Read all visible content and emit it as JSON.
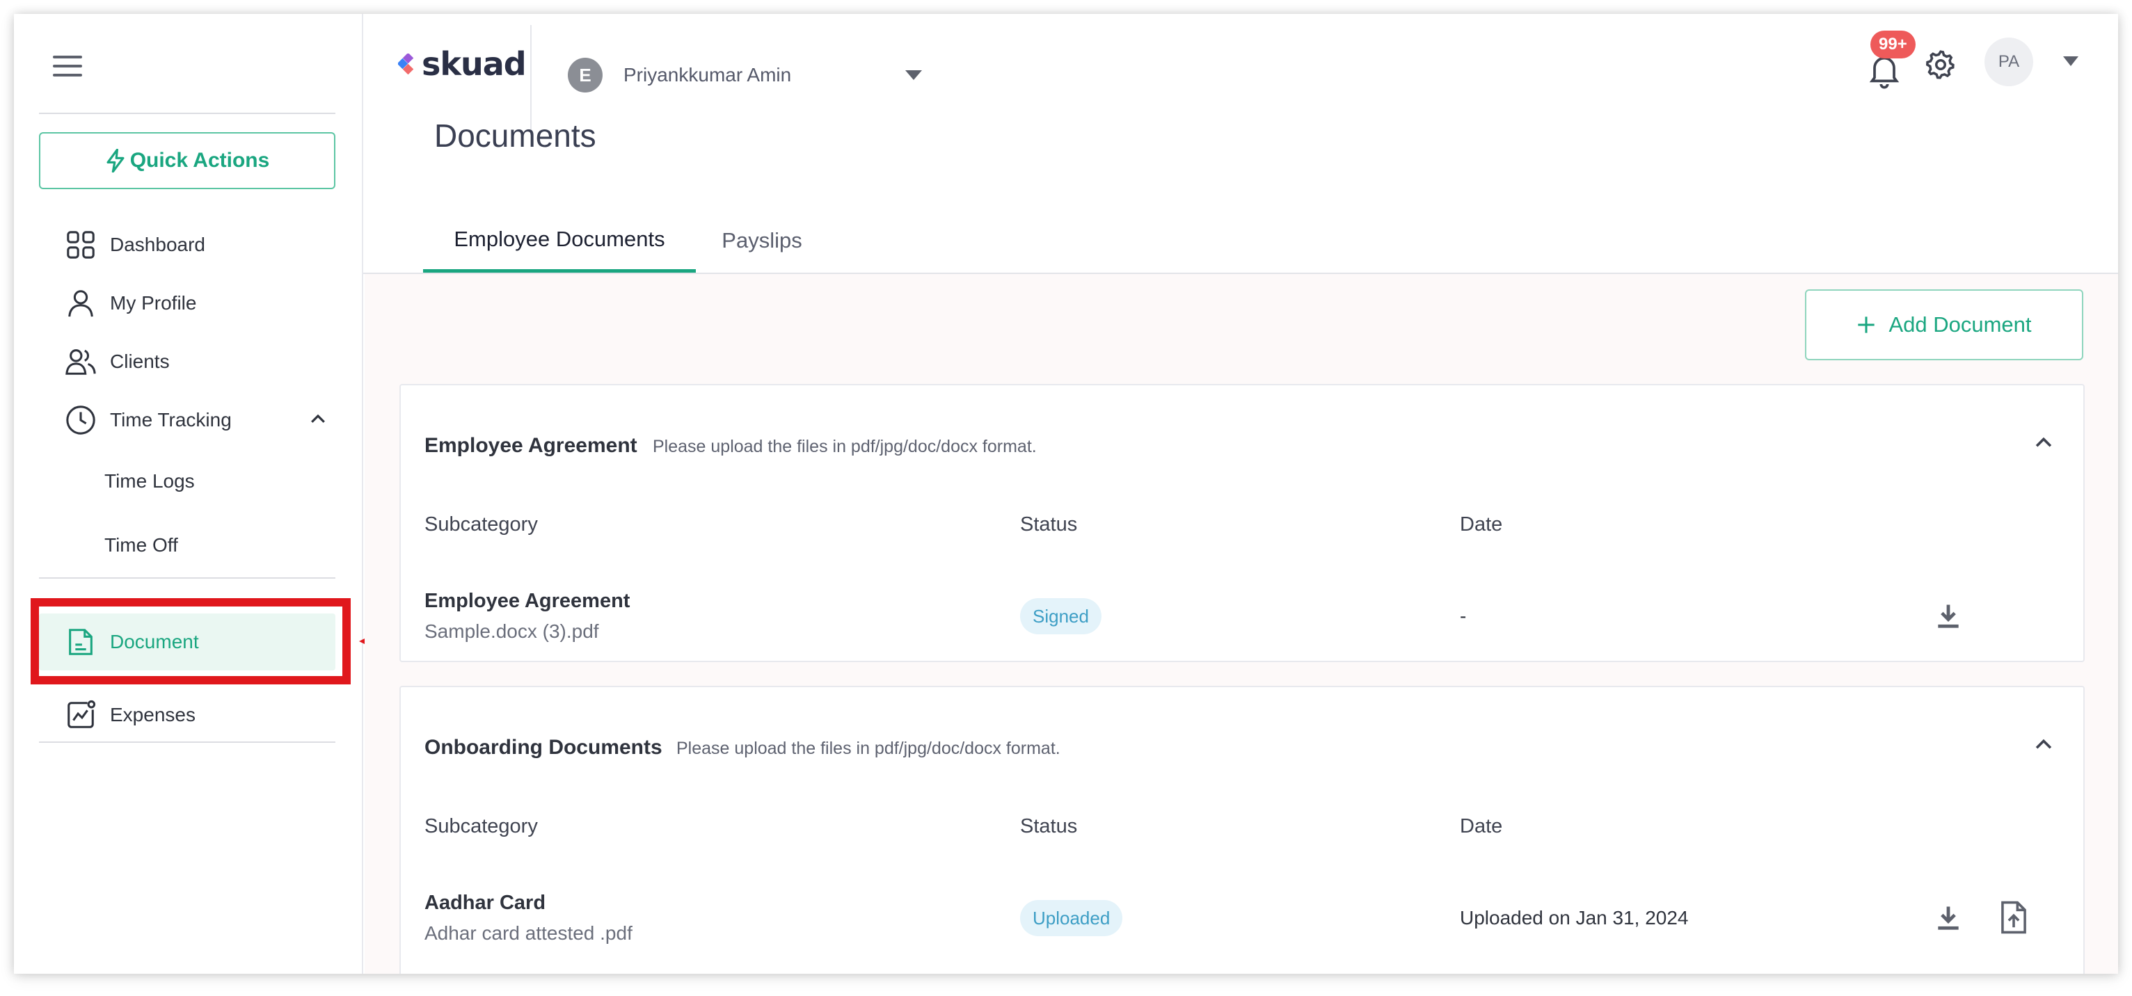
{
  "sidebar": {
    "quick_actions_label": "Quick Actions",
    "items": [
      {
        "label": "Dashboard",
        "icon": "dashboard-grid-icon"
      },
      {
        "label": "My Profile",
        "icon": "user-icon"
      },
      {
        "label": "Clients",
        "icon": "clients-icon"
      },
      {
        "label": "Time Tracking",
        "icon": "clock-icon",
        "expanded": true
      },
      {
        "label": "Time Logs"
      },
      {
        "label": "Time Off"
      },
      {
        "label": "Document",
        "icon": "document-icon",
        "active": true
      },
      {
        "label": "Expenses",
        "icon": "expenses-chart-icon"
      }
    ]
  },
  "header": {
    "logo_text": "skuad",
    "client": {
      "initial": "E",
      "name": "Priyankkumar Amin"
    },
    "notifications_badge": "99+",
    "user_initials": "PA"
  },
  "page": {
    "title": "Documents",
    "tabs": [
      {
        "label": "Employee Documents",
        "active": true
      },
      {
        "label": "Payslips",
        "active": false
      }
    ],
    "add_document_label": "Add Document"
  },
  "sections": [
    {
      "title": "Employee Agreement",
      "hint": "Please upload the files in pdf/jpg/doc/docx format.",
      "columns": [
        "Subcategory",
        "Status",
        "Date"
      ],
      "rows": [
        {
          "name": "Employee Agreement",
          "file": "Sample.docx (3).pdf",
          "status": "Signed",
          "date": "-"
        }
      ]
    },
    {
      "title": "Onboarding Documents",
      "hint": "Please upload the files in pdf/jpg/doc/docx format.",
      "columns": [
        "Subcategory",
        "Status",
        "Date"
      ],
      "rows": [
        {
          "name": "Aadhar Card",
          "file": "Adhar card attested .pdf",
          "status": "Uploaded",
          "date": "Uploaded on Jan 31, 2024"
        }
      ]
    }
  ],
  "colors": {
    "accent": "#1aa680",
    "highlight": "#e0171c",
    "badge": "#ee5a5a",
    "status_bg": "#e4f3fa",
    "status_text": "#3d9ec5"
  }
}
